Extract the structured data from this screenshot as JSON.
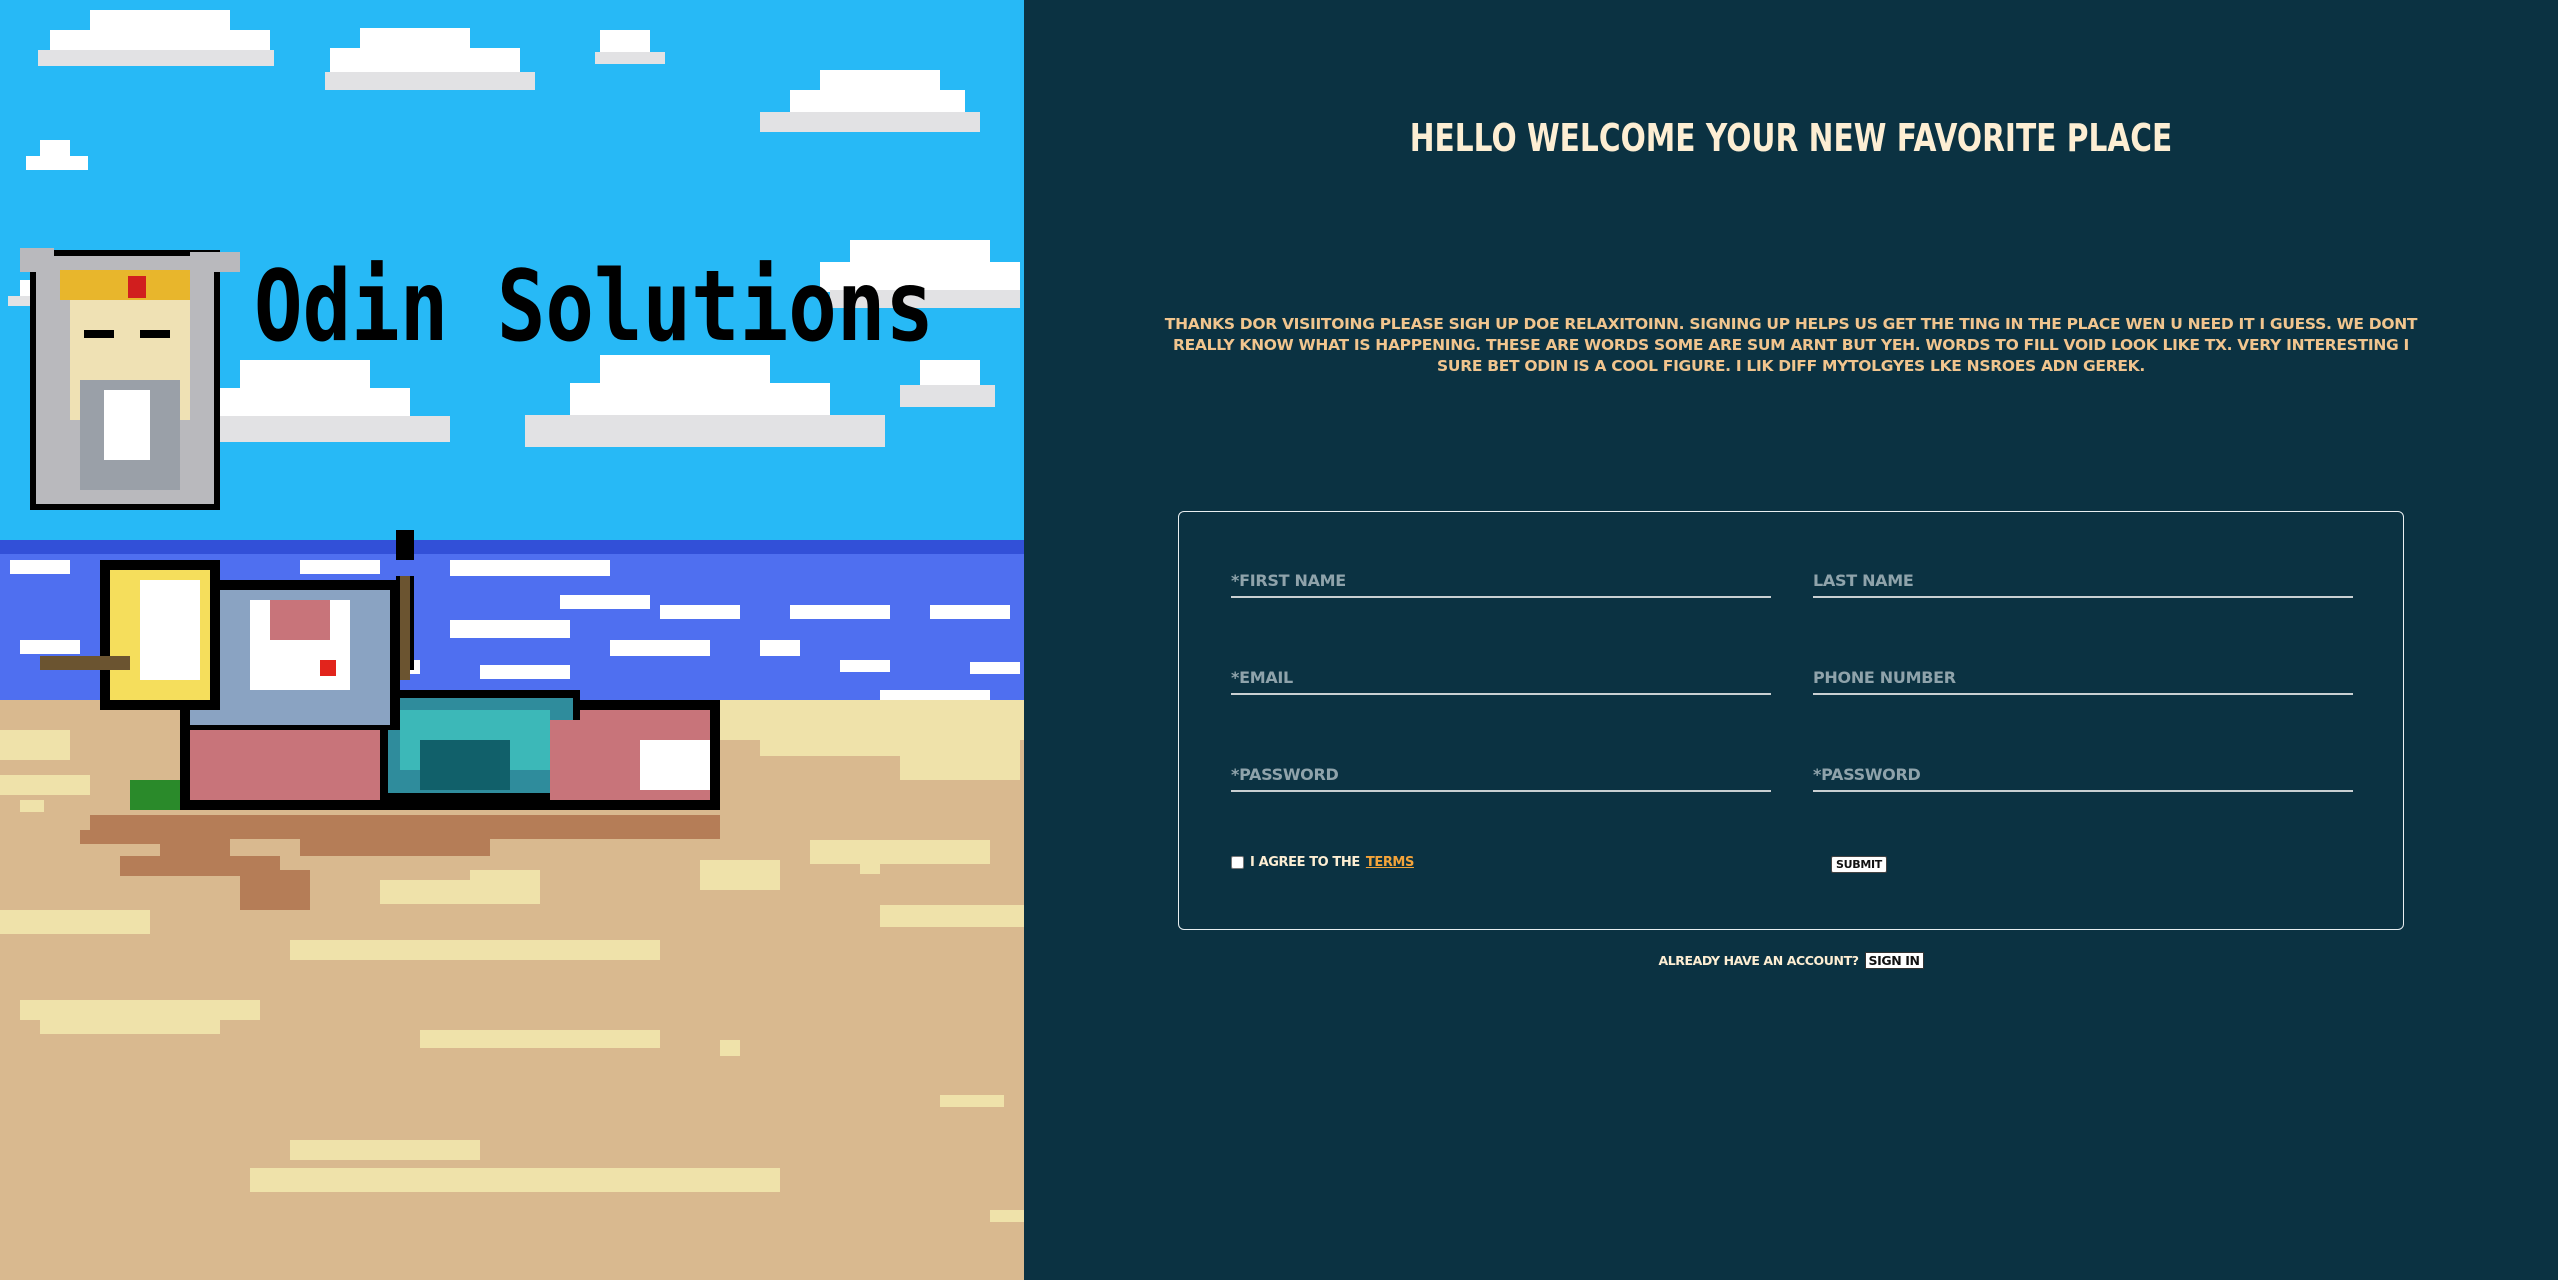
{
  "art": {
    "logo_text": "Odin Solutions"
  },
  "main": {
    "headline": "HELLO WELCOME YOUR NEW FAVORITE PLACE",
    "intro": "THANKS DOR VISIITOING PLEASE SIGH UP DOE RELAXITOINN. SIGNING UP HELPS US GET THE TING IN THE PLACE WEN U NEED IT I GUESS. WE DONT REALLY KNOW WHAT IS HAPPENING. THESE ARE WORDS SOME ARE SUM ARNT BUT YEH. WORDS TO FILL VOID LOOK LIKE TX. VERY INTERESTING I SURE BET ODIN IS A COOL FIGURE. I LIK DIFF MYTOLGYES LKE NSROES ADN GEREK."
  },
  "form": {
    "first_name_placeholder": "*FIRST NAME",
    "last_name_placeholder": "LAST NAME",
    "email_placeholder": "*EMAIL",
    "phone_placeholder": "PHONE NUMBER",
    "password_placeholder": "*PASSWORD",
    "confirm_password_placeholder": "*PASSWORD",
    "agree_label": "I AGREE TO THE",
    "terms_link": "TERMS",
    "submit_label": "SUBMIT"
  },
  "footer": {
    "already_text": "ALREADY HAVE AN ACCOUNT?",
    "signin_label": "SIGN IN"
  },
  "colors": {
    "panel_bg": "#0b3242",
    "sky": "#27b9f6",
    "sea": "#4f6ff0",
    "sand": "#d9b98f",
    "headline": "#fdeed3",
    "intro": "#f1c58e",
    "terms_link": "#f4a43a"
  }
}
